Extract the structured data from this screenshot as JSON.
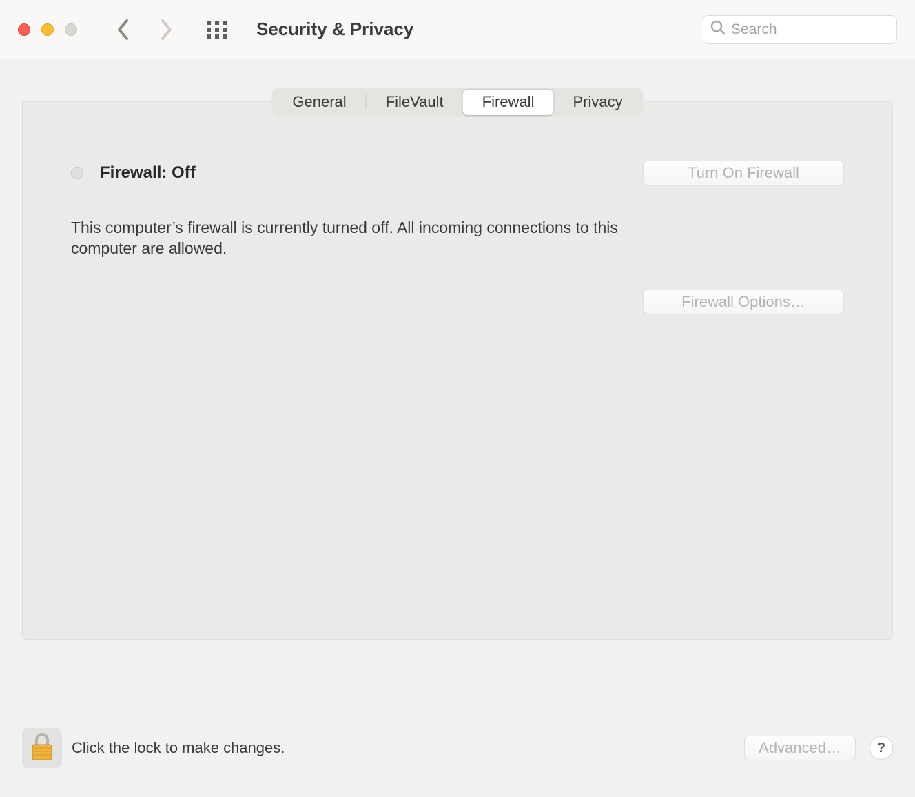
{
  "window": {
    "title": "Security & Privacy"
  },
  "search": {
    "placeholder": "Search",
    "value": ""
  },
  "tabs": {
    "general": "General",
    "filevault": "FileVault",
    "firewall": "Firewall",
    "privacy": "Privacy",
    "active": "firewall"
  },
  "firewall": {
    "status_label": "Firewall: Off",
    "turn_on_label": "Turn On Firewall",
    "description": "This computer’s firewall is currently turned off. All incoming connections to this computer are allowed.",
    "options_label": "Firewall Options…"
  },
  "footer": {
    "lock_hint": "Click the lock to make changes.",
    "advanced_label": "Advanced…",
    "help_label": "?"
  }
}
